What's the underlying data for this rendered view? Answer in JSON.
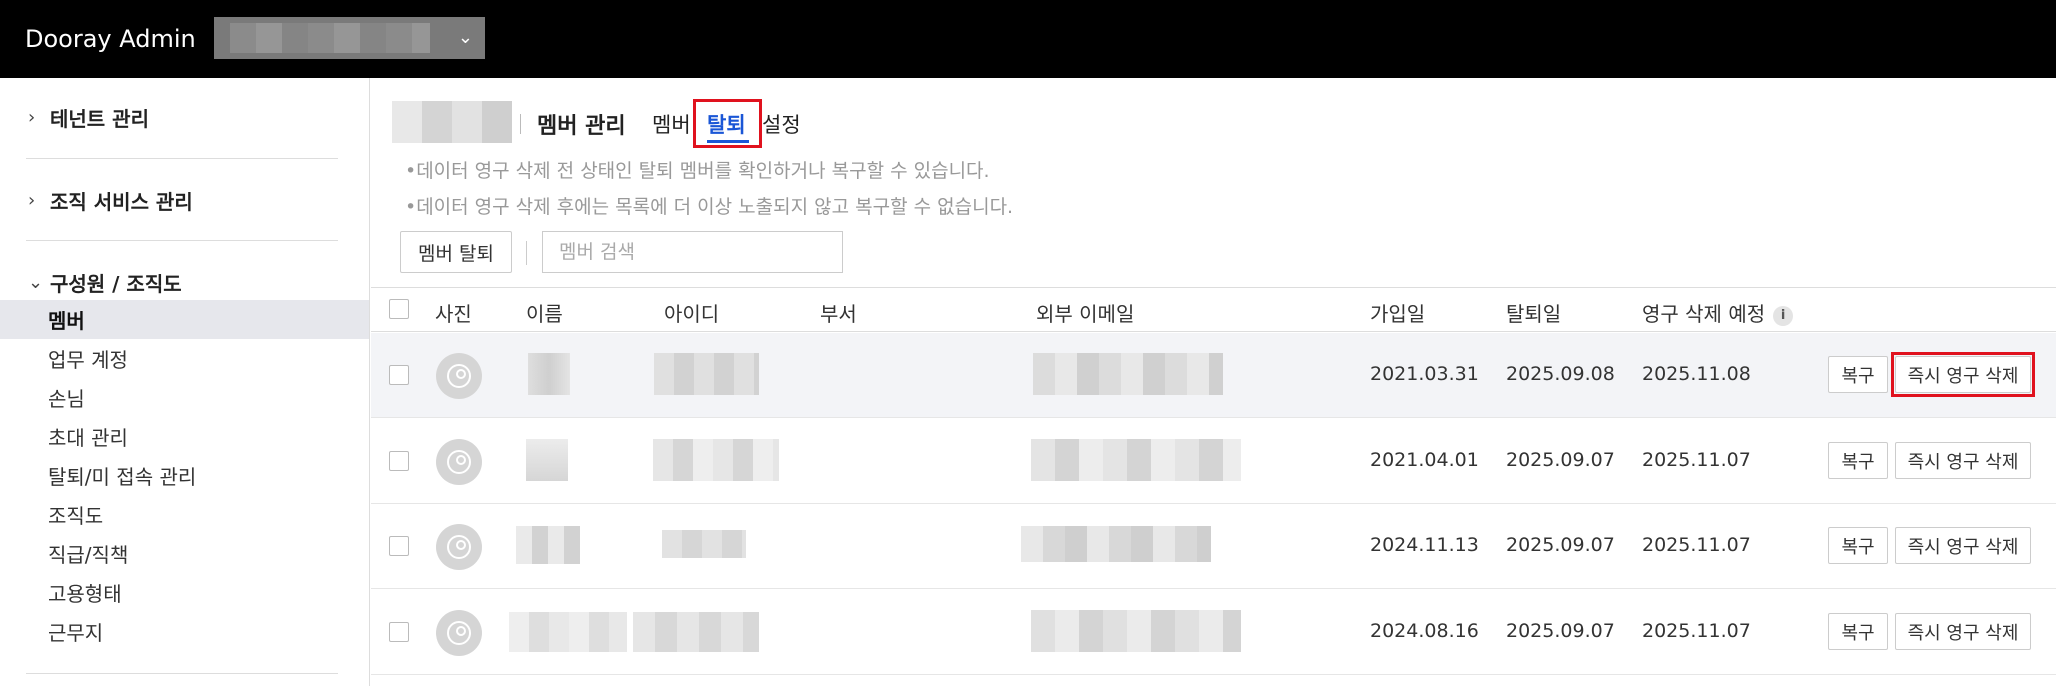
{
  "app": {
    "title": "Dooray Admin",
    "tenant_select_icon": "chevron-down-icon"
  },
  "sidebar": {
    "sections": [
      {
        "label": "테넌트 관리",
        "expanded": false
      },
      {
        "label": "조직 서비스 관리",
        "expanded": false
      },
      {
        "label": "구성원 / 조직도",
        "expanded": true
      }
    ],
    "items": [
      {
        "label": "멤버",
        "active": true
      },
      {
        "label": "업무 계정"
      },
      {
        "label": "손님"
      },
      {
        "label": "초대 관리"
      },
      {
        "label": "탈퇴/미 접속 관리"
      },
      {
        "label": "조직도"
      },
      {
        "label": "직급/직책"
      },
      {
        "label": "고용형태"
      },
      {
        "label": "근무지"
      }
    ]
  },
  "main": {
    "page_title": "멤버 관리",
    "tabs": [
      {
        "label": "멤버"
      },
      {
        "label": "탈퇴",
        "active": true
      },
      {
        "label": "설정"
      }
    ],
    "notes": [
      "•데이터 영구 삭제 전 상태인 탈퇴 멤버를 확인하거나 복구할 수 있습니다.",
      "•데이터 영구 삭제 후에는 목록에 더 이상 노출되지 않고 복구할 수 없습니다."
    ],
    "withdraw_button": "멤버 탈퇴",
    "search_placeholder": "멤버 검색",
    "table": {
      "columns": [
        "사진",
        "이름",
        "아이디",
        "부서",
        "외부 이메일",
        "가입일",
        "탈퇴일",
        "영구 삭제 예정"
      ],
      "rows": [
        {
          "joined": "2021.03.31",
          "left": "2025.09.08",
          "delete_due": "2025.11.08",
          "restore": "복구",
          "delete": "즉시 영구 삭제"
        },
        {
          "joined": "2021.04.01",
          "left": "2025.09.07",
          "delete_due": "2025.11.07",
          "restore": "복구",
          "delete": "즉시 영구 삭제"
        },
        {
          "joined": "2024.11.13",
          "left": "2025.09.07",
          "delete_due": "2025.11.07",
          "restore": "복구",
          "delete": "즉시 영구 삭제"
        },
        {
          "joined": "2024.08.16",
          "left": "2025.09.07",
          "delete_due": "2025.11.07",
          "restore": "복구",
          "delete": "즉시 영구 삭제"
        }
      ]
    }
  },
  "colors": {
    "topbar": "#000000",
    "active_tab": "#1a56d6",
    "highlight_box": "#e0121e",
    "active_row": "#f3f4f7"
  }
}
